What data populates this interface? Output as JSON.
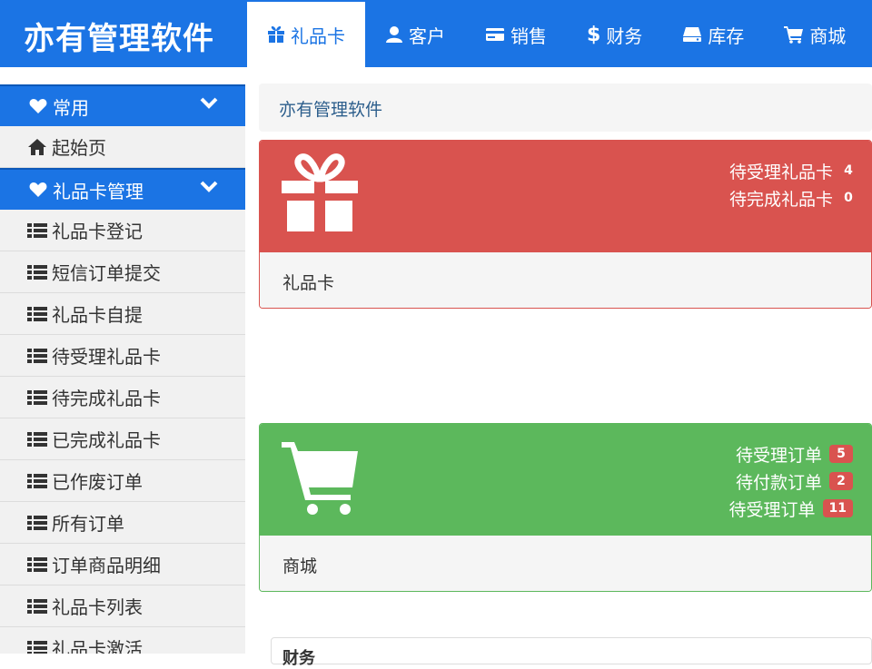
{
  "brand": {
    "title": "亦有管理软件"
  },
  "nav": [
    {
      "label": "礼品卡",
      "icon": "gift-icon",
      "active": true
    },
    {
      "label": "客户",
      "icon": "user-icon"
    },
    {
      "label": "销售",
      "icon": "credit-card-icon"
    },
    {
      "label": "财务",
      "icon": "dollar-icon"
    },
    {
      "label": "库存",
      "icon": "hdd-icon"
    },
    {
      "label": "商城",
      "icon": "shopping-cart-icon"
    }
  ],
  "sidebar": {
    "group_common": {
      "label": "常用",
      "icon": "heart-icon"
    },
    "home": {
      "label": "起始页",
      "icon": "home-icon"
    },
    "group_giftcard": {
      "label": "礼品卡管理",
      "icon": "heart-icon"
    },
    "items": [
      {
        "label": "礼品卡登记"
      },
      {
        "label": "短信订单提交"
      },
      {
        "label": "礼品卡自提"
      },
      {
        "label": "待受理礼品卡"
      },
      {
        "label": "待完成礼品卡"
      },
      {
        "label": "已完成礼品卡"
      },
      {
        "label": "已作废订单"
      },
      {
        "label": "所有订单"
      },
      {
        "label": "订单商品明细"
      },
      {
        "label": "礼品卡列表"
      },
      {
        "label": "礼品卡激活"
      }
    ]
  },
  "breadcrumb": {
    "text": "亦有管理软件"
  },
  "giftcard_panel": {
    "icon": "gift-icon",
    "stats": [
      {
        "label": "待受理礼品卡",
        "count": "4"
      },
      {
        "label": "待完成礼品卡",
        "count": "0"
      }
    ],
    "footer": "礼品卡"
  },
  "mall_panel": {
    "icon": "shopping-cart-icon",
    "stats": [
      {
        "label": "待受理订单",
        "count": "5"
      },
      {
        "label": "待付款订单",
        "count": "2"
      },
      {
        "label": "待受理订单",
        "count": "11"
      }
    ],
    "footer": "商城"
  },
  "finance_panel": {
    "title": "财务"
  },
  "colors": {
    "primary": "#1b74e4",
    "danger": "#d9534f",
    "success": "#5cb85c"
  }
}
